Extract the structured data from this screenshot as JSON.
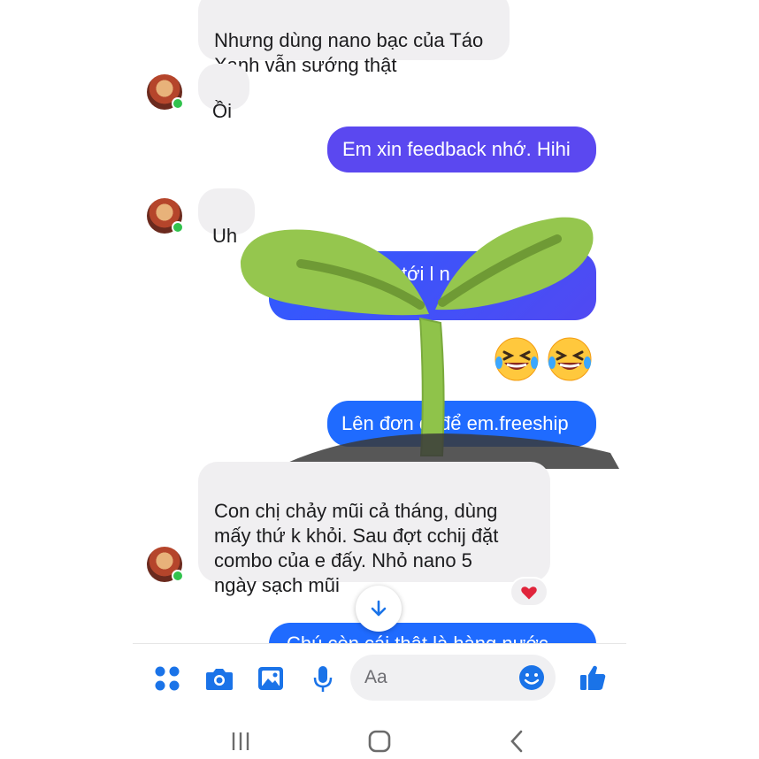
{
  "messages": [
    {
      "side": "in",
      "text": "Nhưng dùng nano bạc của Táo\nXanh vẫn sướng thật"
    },
    {
      "side": "in",
      "text": "Ồi"
    },
    {
      "side": "out",
      "text": "Em xin feedback nhớ. Hihi"
    },
    {
      "side": "in",
      "text": "Uh"
    },
    {
      "side": "out",
      "text": "tới l                n"
    },
    {
      "side": "out",
      "text": "Lên đơn đi để em.freeship"
    },
    {
      "side": "in",
      "text": "Con chị chảy mũi cả tháng, dùng\nmấy thứ k khỏi. Sau đợt cchij đặt\ncombo của e đấy. Nhỏ nano 5\nngày sạch mũi"
    },
    {
      "side": "out",
      "text": "Chú còn cái thật là hàng nước"
    }
  ],
  "emojis": [
    "rolling-on-floor-laughing",
    "rolling-on-floor-laughing"
  ],
  "reaction": "heart",
  "composer": {
    "placeholder": "Aa"
  },
  "colors": {
    "outgoing_purple": "#5b48f0",
    "outgoing_blue": "#1f6bff",
    "incoming_gray": "#f0eff1",
    "icon_blue": "#1a73e8",
    "sprout_green": "#8fc34a"
  }
}
